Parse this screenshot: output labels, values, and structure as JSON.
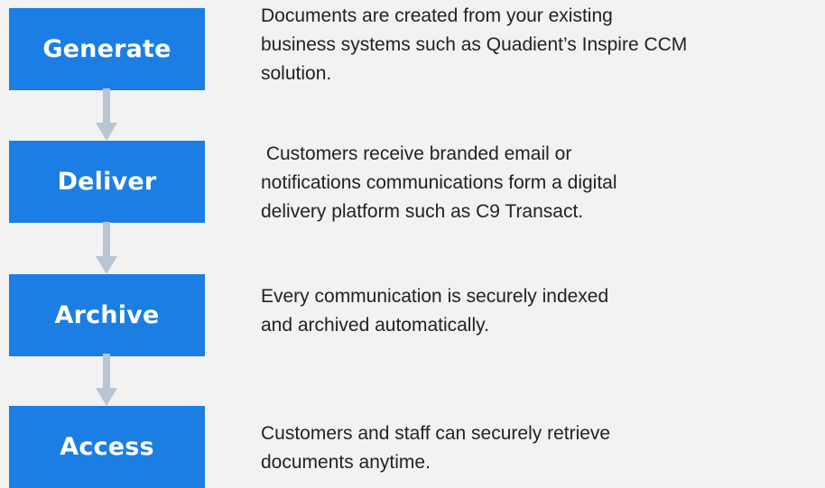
{
  "steps": [
    {
      "label": "Generate",
      "lines": [
        "Documents are created from your existing",
        "business systems such as Quadient’s Inspire CCM",
        "solution."
      ]
    },
    {
      "label": "Deliver",
      "lines": [
        " Customers receive branded email or",
        "notifications communications form a digital",
        "delivery platform such as C9 Transact."
      ]
    },
    {
      "label": "Archive",
      "lines": [
        "Every communication is securely indexed",
        "and archived automatically."
      ]
    },
    {
      "label": "Access",
      "lines": [
        "Customers and staff can securely retrieve",
        "documents anytime."
      ]
    }
  ],
  "colors": {
    "box": "#1b7ee4",
    "box_text": "#ffffff",
    "connector": "#b7c6d2",
    "background": "#f2f2f2",
    "text": "#222222"
  }
}
